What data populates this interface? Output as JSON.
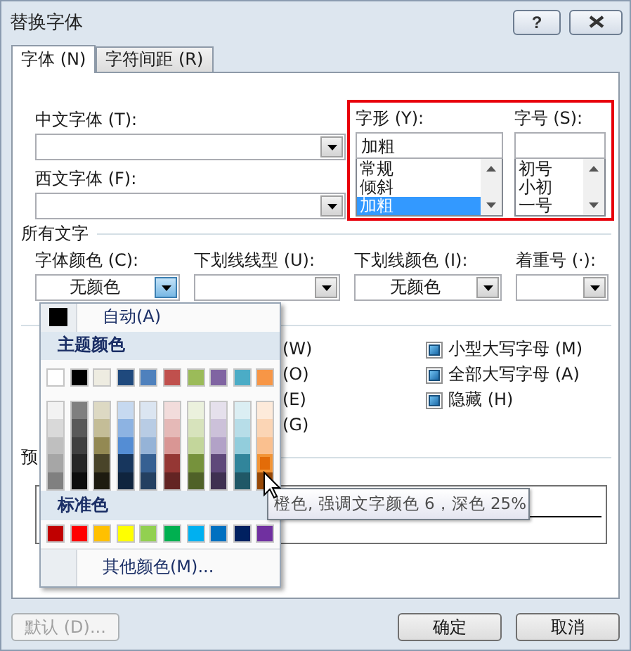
{
  "window": {
    "title": "替换字体",
    "help_button": "?"
  },
  "tabs": [
    {
      "label": "字体 (N)",
      "selected": true
    },
    {
      "label": "字符间距 (R)",
      "selected": false
    }
  ],
  "font_fields": [
    {
      "label": "中文字体 (T):"
    },
    {
      "label": "西文字体 (F):"
    }
  ],
  "style": {
    "label": "字形 (Y):",
    "value": "加粗",
    "options": [
      {
        "label": "常规",
        "selected": false
      },
      {
        "label": "倾斜",
        "selected": false
      },
      {
        "label": "加粗",
        "selected": true
      }
    ]
  },
  "size": {
    "label": "字号 (S):",
    "options": [
      {
        "label": "初号",
        "selected": false
      },
      {
        "label": "小初",
        "selected": false
      },
      {
        "label": "一号",
        "selected": false
      }
    ]
  },
  "all_text": {
    "heading": "所有文字",
    "fields": [
      {
        "label": "字体颜色 (C):",
        "value": "无颜色",
        "open": true
      },
      {
        "label": "下划线线型 (U):",
        "open": false
      },
      {
        "label": "下划线颜色 (I):",
        "value": "无颜色",
        "open": false
      },
      {
        "label": "着重号 (·):",
        "open": false
      }
    ]
  },
  "effects": {
    "left": [
      {
        "label": "(W)"
      },
      {
        "label": "(O)"
      },
      {
        "label": "(E)"
      },
      {
        "label": "(G)"
      }
    ],
    "right": [
      {
        "label": "小型大写字母 (M)",
        "mixed": true
      },
      {
        "label": "全部大写字母 (A)",
        "mixed": true
      },
      {
        "label": "隐藏 (H)",
        "mixed": true
      }
    ]
  },
  "preview": {
    "heading": "预"
  },
  "color_menu": {
    "automatic": "自动(A)",
    "theme_heading": "主题颜色",
    "theme": [
      {
        "color": "#ffffff",
        "hovered": false
      },
      {
        "color": "#000000",
        "hovered": false
      },
      {
        "color": "#eeece1",
        "hovered": false
      },
      {
        "color": "#1f497d",
        "hovered": false
      },
      {
        "color": "#4f81bd",
        "hovered": false
      },
      {
        "color": "#c0504d",
        "hovered": false
      },
      {
        "color": "#9bbb59",
        "hovered": false
      },
      {
        "color": "#8064a2",
        "hovered": false
      },
      {
        "color": "#4bacc6",
        "hovered": false
      },
      {
        "color": "#f79646",
        "hovered": false
      }
    ],
    "shades": [
      [
        {
          "color": "#f2f2f2",
          "hovered": false
        },
        {
          "color": "#d9d9d9",
          "hovered": false
        },
        {
          "color": "#bfbfbf",
          "hovered": false
        },
        {
          "color": "#a6a6a6",
          "hovered": false
        },
        {
          "color": "#808080",
          "hovered": false
        }
      ],
      [
        {
          "color": "#7f7f7f",
          "hovered": false
        },
        {
          "color": "#595959",
          "hovered": false
        },
        {
          "color": "#404040",
          "hovered": false
        },
        {
          "color": "#262626",
          "hovered": false
        },
        {
          "color": "#0d0d0d",
          "hovered": false
        }
      ],
      [
        {
          "color": "#ddd9c3",
          "hovered": false
        },
        {
          "color": "#c4bd97",
          "hovered": false
        },
        {
          "color": "#938953",
          "hovered": false
        },
        {
          "color": "#494429",
          "hovered": false
        },
        {
          "color": "#1d1b10",
          "hovered": false
        }
      ],
      [
        {
          "color": "#c6d9f0",
          "hovered": false
        },
        {
          "color": "#8db3e2",
          "hovered": false
        },
        {
          "color": "#548dd4",
          "hovered": false
        },
        {
          "color": "#17365d",
          "hovered": false
        },
        {
          "color": "#0f243e",
          "hovered": false
        }
      ],
      [
        {
          "color": "#dbe5f1",
          "hovered": false
        },
        {
          "color": "#b8cce4",
          "hovered": false
        },
        {
          "color": "#95b3d7",
          "hovered": false
        },
        {
          "color": "#366092",
          "hovered": false
        },
        {
          "color": "#244061",
          "hovered": false
        }
      ],
      [
        {
          "color": "#f2dcdb",
          "hovered": false
        },
        {
          "color": "#e5b9b7",
          "hovered": false
        },
        {
          "color": "#d99694",
          "hovered": false
        },
        {
          "color": "#953734",
          "hovered": false
        },
        {
          "color": "#632423",
          "hovered": false
        }
      ],
      [
        {
          "color": "#ebf1dd",
          "hovered": false
        },
        {
          "color": "#d7e3bc",
          "hovered": false
        },
        {
          "color": "#c3d69b",
          "hovered": false
        },
        {
          "color": "#76923c",
          "hovered": false
        },
        {
          "color": "#4f6128",
          "hovered": false
        }
      ],
      [
        {
          "color": "#e5e0ec",
          "hovered": false
        },
        {
          "color": "#ccc1d9",
          "hovered": false
        },
        {
          "color": "#b2a2c7",
          "hovered": false
        },
        {
          "color": "#5f497a",
          "hovered": false
        },
        {
          "color": "#3f3151",
          "hovered": false
        }
      ],
      [
        {
          "color": "#dbeef3",
          "hovered": false
        },
        {
          "color": "#b7dde8",
          "hovered": false
        },
        {
          "color": "#92cddc",
          "hovered": false
        },
        {
          "color": "#31859b",
          "hovered": false
        },
        {
          "color": "#205867",
          "hovered": false
        }
      ],
      [
        {
          "color": "#fdeada",
          "hovered": false
        },
        {
          "color": "#fbd5b5",
          "hovered": false
        },
        {
          "color": "#fac08f",
          "hovered": false
        },
        {
          "color": "#e36c09",
          "hovered": true
        },
        {
          "color": "#974806",
          "hovered": false
        }
      ]
    ],
    "standard_heading": "标准色",
    "standard": [
      {
        "color": "#c00000",
        "hovered": false
      },
      {
        "color": "#ff0000",
        "hovered": false
      },
      {
        "color": "#ffc000",
        "hovered": false
      },
      {
        "color": "#ffff00",
        "hovered": false
      },
      {
        "color": "#92d050",
        "hovered": false
      },
      {
        "color": "#00b050",
        "hovered": false
      },
      {
        "color": "#00b0f0",
        "hovered": false
      },
      {
        "color": "#0070c0",
        "hovered": false
      },
      {
        "color": "#002060",
        "hovered": false
      },
      {
        "color": "#7030a0",
        "hovered": false
      }
    ],
    "more": "其他颜色(M)..."
  },
  "tooltip": "橙色, 强调文字颜色 6，深色 25%",
  "buttons": [
    {
      "label": "默认 (D)...",
      "disabled": true
    },
    {
      "label": "确定",
      "disabled": false
    },
    {
      "label": "取消",
      "disabled": false
    }
  ]
}
